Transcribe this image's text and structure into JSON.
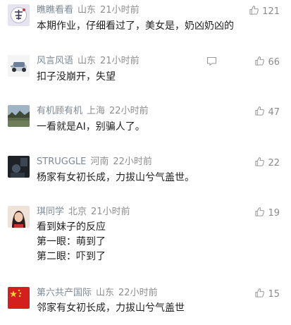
{
  "comments": [
    {
      "user": "瞧瞧看看",
      "location": "山东",
      "time": "21小时前",
      "likes": "121",
      "lines": [
        "本期作业，仔细看过了，美女是，奶凶奶凶的"
      ],
      "avatar_color": "#e6e4ee"
    },
    {
      "user": "风言风语",
      "location": "山东",
      "time": "21小时前",
      "likes": "66",
      "lines": [
        "扣子没崩开，失望"
      ],
      "avatar_color": "#f2f2f2"
    },
    {
      "user": "有机顾有机",
      "location": "上海",
      "time": "22小时前",
      "likes": "47",
      "lines": [
        "一看就是AI，别骗人了。"
      ],
      "avatar_color": "#5b6b4c"
    },
    {
      "user": "STRUGGLE",
      "location": "河南",
      "time": "22小时前",
      "likes": "22",
      "lines": [
        "杨家有女初长成，力拔山兮气盖世。"
      ],
      "avatar_color": "#2a2f35"
    },
    {
      "user": "琪同学",
      "location": "北京",
      "time": "21小时前",
      "likes": "19",
      "lines": [
        "看到妹子的反应",
        "第一眼：萌到了",
        "第二眼：吓到了"
      ],
      "avatar_color": "#e8d3c5"
    },
    {
      "user": "第六共产国际",
      "location": "山东",
      "time": "22小时前",
      "likes": "15",
      "lines": [
        "邻家有女初长成，力拔山兮气盖世"
      ],
      "avatar_color": "#d41f1f"
    }
  ],
  "colors": {
    "username": "#7d8a96",
    "meta": "#8e8e8e",
    "body": "#1f1f1f",
    "like": "#8a8a8a"
  }
}
